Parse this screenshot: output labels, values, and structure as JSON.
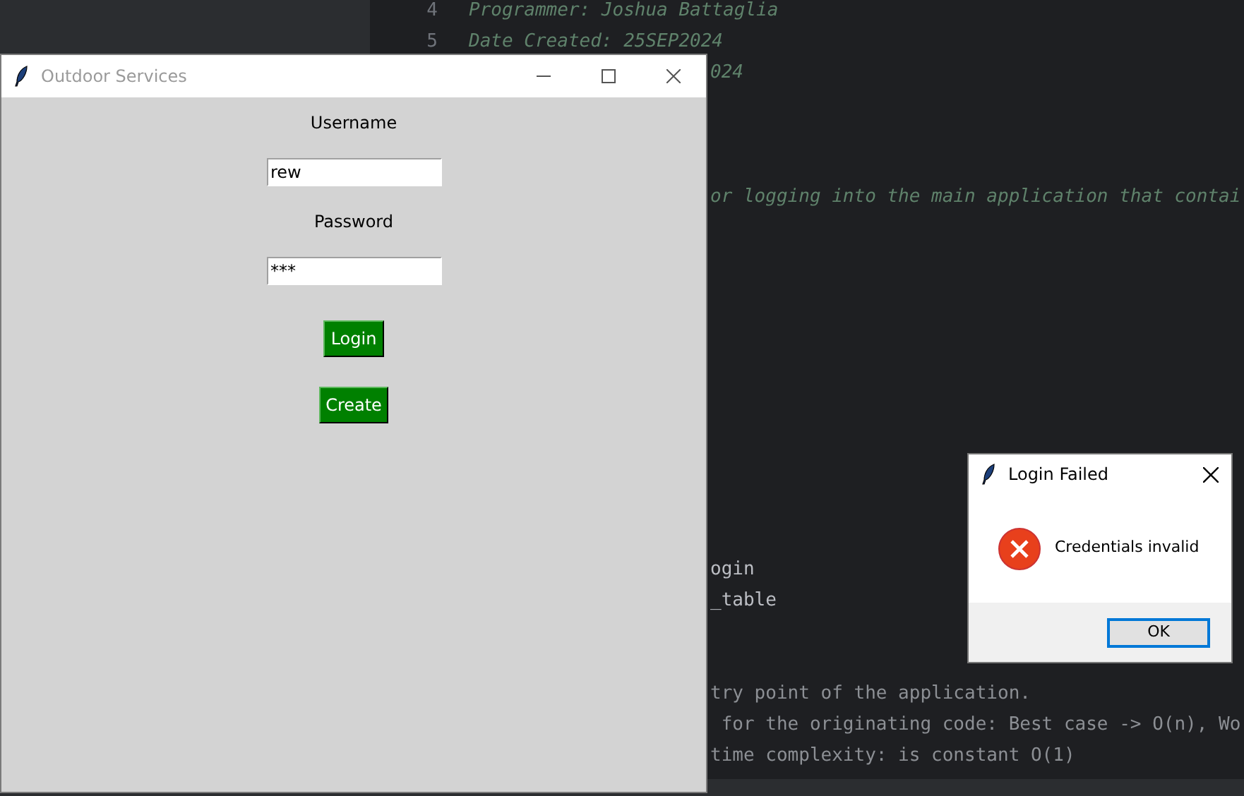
{
  "editor": {
    "lines": [
      {
        "number": "4",
        "text": "Programmer: Joshua Battaglia",
        "kind": "comment"
      },
      {
        "number": "5",
        "text": "Date Created: 25SEP2024",
        "kind": "comment"
      },
      {
        "text": "024",
        "kind": "fragment-comment"
      },
      {
        "kind": "blank"
      },
      {
        "kind": "blank"
      },
      {
        "kind": "blank"
      },
      {
        "text": "or logging into the main application that contai",
        "kind": "fragment-comment"
      },
      {
        "kind": "blank"
      },
      {
        "kind": "blank"
      },
      {
        "kind": "blank"
      },
      {
        "kind": "blank"
      },
      {
        "kind": "blank"
      },
      {
        "kind": "blank"
      },
      {
        "kind": "blank"
      },
      {
        "kind": "blank"
      },
      {
        "kind": "blank"
      },
      {
        "kind": "blank"
      },
      {
        "kind": "blank"
      },
      {
        "text": "ogin",
        "kind": "fragment-code"
      },
      {
        "text": "_table",
        "kind": "fragment-code"
      },
      {
        "kind": "blank"
      },
      {
        "kind": "blank"
      },
      {
        "text": "try point of the application.",
        "kind": "fragment-doc"
      },
      {
        "text": " for the originating code: Best case -> O(n), Wo",
        "kind": "fragment-doc"
      },
      {
        "text": "time complexity: is constant O(1)",
        "kind": "fragment-doc"
      }
    ]
  },
  "main_window": {
    "title": "Outdoor Services",
    "fields": [
      {
        "label": "Username",
        "value": "rew"
      },
      {
        "label": "Password",
        "value": "***"
      }
    ],
    "buttons": [
      "Login",
      "Create"
    ]
  },
  "dialog": {
    "title": "Login Failed",
    "message": "Credentials invalid",
    "button": "OK"
  }
}
